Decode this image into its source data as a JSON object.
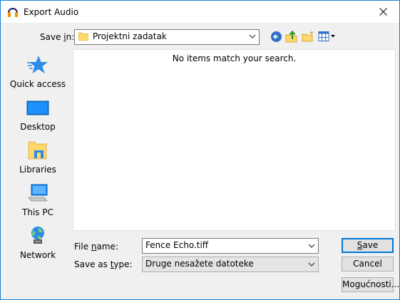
{
  "window": {
    "title": "Export Audio"
  },
  "toolbar": {
    "save_in_label": "Save in:",
    "location": "Projektni zadatak",
    "icons": [
      "back-icon",
      "up-folder-icon",
      "new-folder-icon",
      "view-menu-icon"
    ]
  },
  "places": [
    {
      "name": "place-quick-access",
      "label": "Quick access",
      "icon": "star-icon"
    },
    {
      "name": "place-desktop",
      "label": "Desktop",
      "icon": "desktop-icon"
    },
    {
      "name": "place-libraries",
      "label": "Libraries",
      "icon": "libraries-icon"
    },
    {
      "name": "place-this-pc",
      "label": "This PC",
      "icon": "computer-icon"
    },
    {
      "name": "place-network",
      "label": "Network",
      "icon": "network-icon"
    }
  ],
  "file_list": {
    "empty_message": "No items match your search."
  },
  "form": {
    "file_name_label_pre": "File ",
    "file_name_label_u": "n",
    "file_name_label_post": "ame:",
    "file_name_value": "Fence Echo.tiff",
    "save_type_label_pre": "Save as ",
    "save_type_label_u": "t",
    "save_type_label_post": "ype:",
    "save_type_value": "Druge nesažete datoteke"
  },
  "buttons": {
    "save_u": "S",
    "save_rest": "ave",
    "cancel": "Cancel",
    "options": "Mogućnosti..."
  },
  "colors": {
    "accent": "#0078d7",
    "window_border": "#1883d7"
  }
}
